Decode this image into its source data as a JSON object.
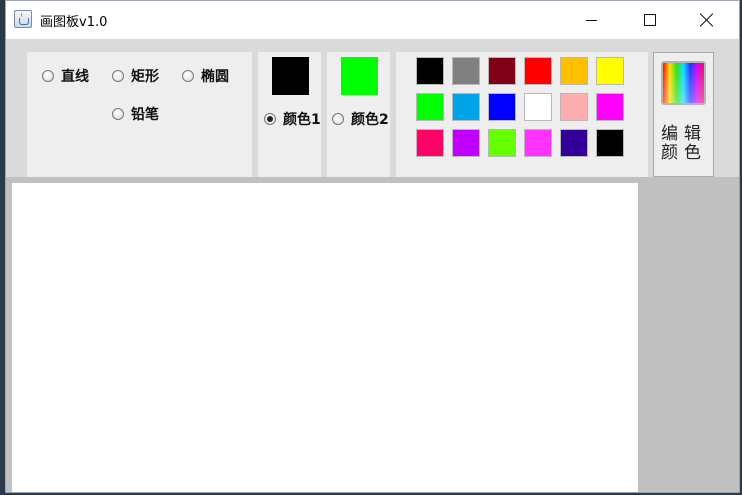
{
  "window": {
    "title": "画图板v1.0"
  },
  "tools": {
    "line": "直线",
    "rect": "矩形",
    "oval": "椭圆",
    "pencil": "铅笔",
    "selected": "none"
  },
  "color1": {
    "label": "颜色1",
    "value": "#000000",
    "selected": true
  },
  "color2": {
    "label": "颜色2",
    "value": "#00ff00",
    "selected": false
  },
  "palette": [
    "#000000",
    "#808080",
    "#800018",
    "#ff0000",
    "#ffc000",
    "#ffff00",
    "#00ff00",
    "#00a2e8",
    "#0000ff",
    "#ffffff",
    "#ffaeb0",
    "#ff00ff",
    "#ff0066",
    "#c000ff",
    "#66ff00",
    "#ff33ff",
    "#330099",
    "#000000"
  ],
  "edit_colors": {
    "label": "编辑颜色"
  },
  "canvas": {
    "background": "#ffffff"
  }
}
